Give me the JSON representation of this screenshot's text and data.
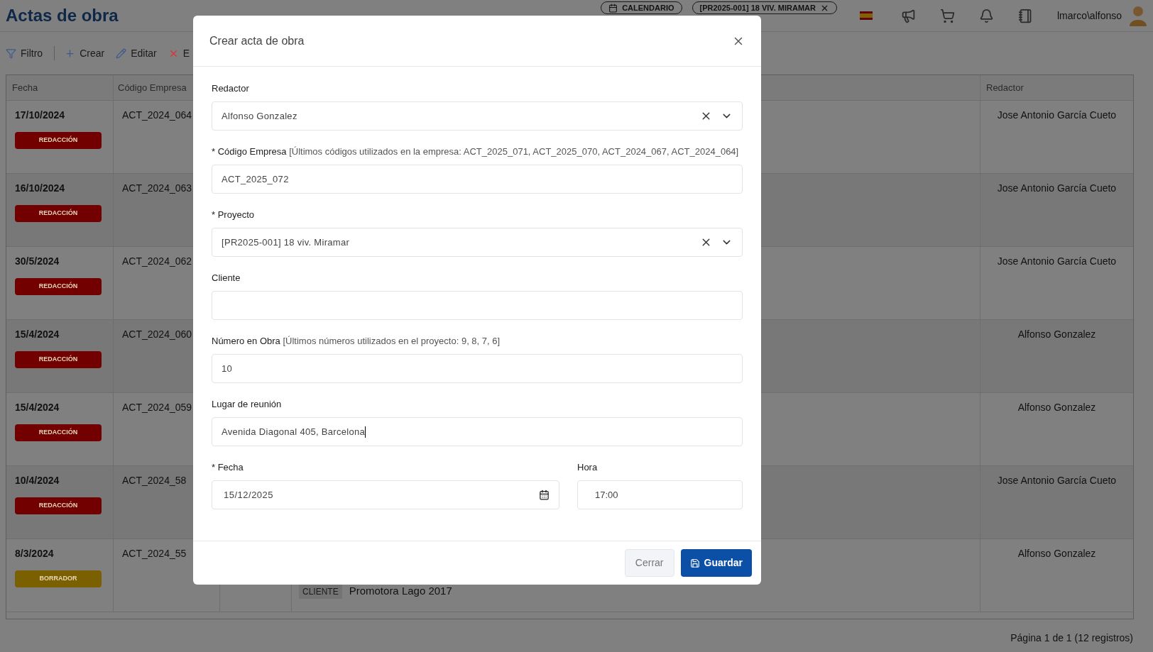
{
  "header": {
    "title": "Actas de obra",
    "chips": [
      {
        "label": "CALENDARIO",
        "kind": "calendar"
      },
      {
        "label": "[PR2025-001] 18 VIV. MIRAMAR",
        "kind": "project"
      }
    ],
    "user": "lmarco\\alfonso"
  },
  "toolbar": [
    {
      "label": "Filtro",
      "kind": "filter"
    },
    {
      "label": "Crear",
      "kind": "create"
    },
    {
      "label": "Editar",
      "kind": "edit"
    },
    {
      "label": "E",
      "kind": "delete"
    }
  ],
  "table": {
    "columns": {
      "fecha": "Fecha",
      "codigo": "Código Empresa",
      "redactor": "Redactor"
    },
    "rows": [
      {
        "fecha": "17/10/2024",
        "status": {
          "label": "REDACCIÓN",
          "color": "#720000"
        },
        "codigo": "ACT_2024_064",
        "redactor": "Jose Antonio García Cueto"
      },
      {
        "fecha": "16/10/2024",
        "status": {
          "label": "REDACCIÓN",
          "color": "#720000"
        },
        "codigo": "ACT_2024_063",
        "redactor": "Jose Antonio García Cueto"
      },
      {
        "fecha": "30/5/2024",
        "status": {
          "label": "REDACCIÓN",
          "color": "#720000"
        },
        "codigo": "ACT_2024_062",
        "redactor": "Jose Antonio García Cueto"
      },
      {
        "fecha": "15/4/2024",
        "status": {
          "label": "REDACCIÓN",
          "color": "#720000"
        },
        "codigo": "ACT_2024_060",
        "redactor": "Alfonso Gonzalez"
      },
      {
        "fecha": "15/4/2024",
        "status": {
          "label": "REDACCIÓN",
          "color": "#720000"
        },
        "codigo": "ACT_2024_059",
        "redactor": "Alfonso Gonzalez"
      },
      {
        "fecha": "10/4/2024",
        "status": {
          "label": "REDACCIÓN",
          "color": "#720000"
        },
        "codigo": "ACT_2024_58",
        "redactor": "Jose Antonio García Cueto"
      },
      {
        "fecha": "8/3/2024",
        "status": {
          "label": "BORRADOR",
          "color": "#7a6000"
        },
        "codigo": "ACT_2024_55",
        "redactor": "Alfonso Gonzalez",
        "cliente_tag": "CLIENTE",
        "cliente": "Promotora Lago 2017"
      }
    ],
    "pagination": "Página 1 de 1 (12 registros)"
  },
  "modal": {
    "title": "Crear acta de obra",
    "fields": [
      {
        "kind": "select",
        "label": "Redactor",
        "value": "Alfonso Gonzalez"
      },
      {
        "kind": "text",
        "label": "* Código Empresa",
        "hint": "[Últimos códigos utilizados en la empresa: ACT_2025_071, ACT_2025_070, ACT_2024_067, ACT_2024_064]",
        "value": "ACT_2025_072"
      },
      {
        "kind": "select",
        "label": "* Proyecto",
        "value": "[PR2025-001] 18 viv. Miramar"
      },
      {
        "kind": "text",
        "label": "Cliente"
      },
      {
        "kind": "text",
        "label": "Número en Obra",
        "hint": "[Últimos números utilizados en el proyecto: 9, 8, 7, 6]",
        "value": "10"
      },
      {
        "kind": "text",
        "label": "Lugar de reunión",
        "value": "Avenida Diagonal 405, Barcelona",
        "focused": true
      },
      {
        "kind": "date",
        "label": "* Fecha",
        "value": "15/12/2025"
      },
      {
        "kind": "time",
        "label": "Hora",
        "value": "17:00"
      }
    ],
    "buttons": [
      {
        "label": "Cerrar",
        "kind": "secondary"
      },
      {
        "label": "Guardar",
        "kind": "primary"
      }
    ]
  }
}
